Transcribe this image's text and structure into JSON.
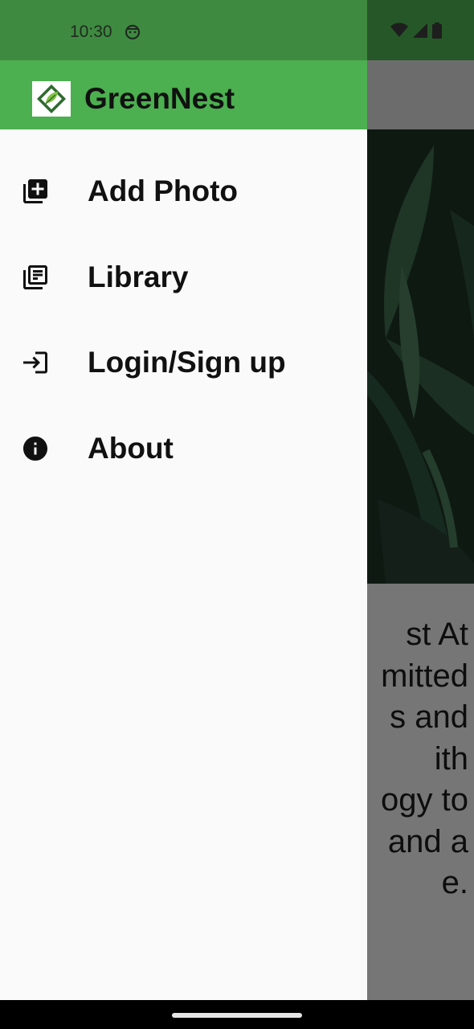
{
  "status_bar": {
    "time": "10:30",
    "icons": [
      "android-face-icon",
      "wifi-icon",
      "cell-signal-icon",
      "battery-icon"
    ]
  },
  "drawer": {
    "app_name": "GreenNest",
    "logo_icon": "greennest-logo-icon",
    "items": [
      {
        "label": "Add Photo",
        "icon": "add-photo-icon"
      },
      {
        "label": "Library",
        "icon": "library-icon"
      },
      {
        "label": "Login/Sign up",
        "icon": "login-icon"
      },
      {
        "label": "About",
        "icon": "info-icon"
      }
    ]
  },
  "background_page": {
    "description_lines": [
      "st At",
      "mitted",
      "s and",
      "ith",
      "ogy to",
      "and a",
      "e."
    ]
  },
  "colors": {
    "primary": "#4caf50",
    "primary_dark": "#3f8a41",
    "drawer_background": "#fafafa",
    "scrim": "rgba(0,0,0,0.5)"
  }
}
